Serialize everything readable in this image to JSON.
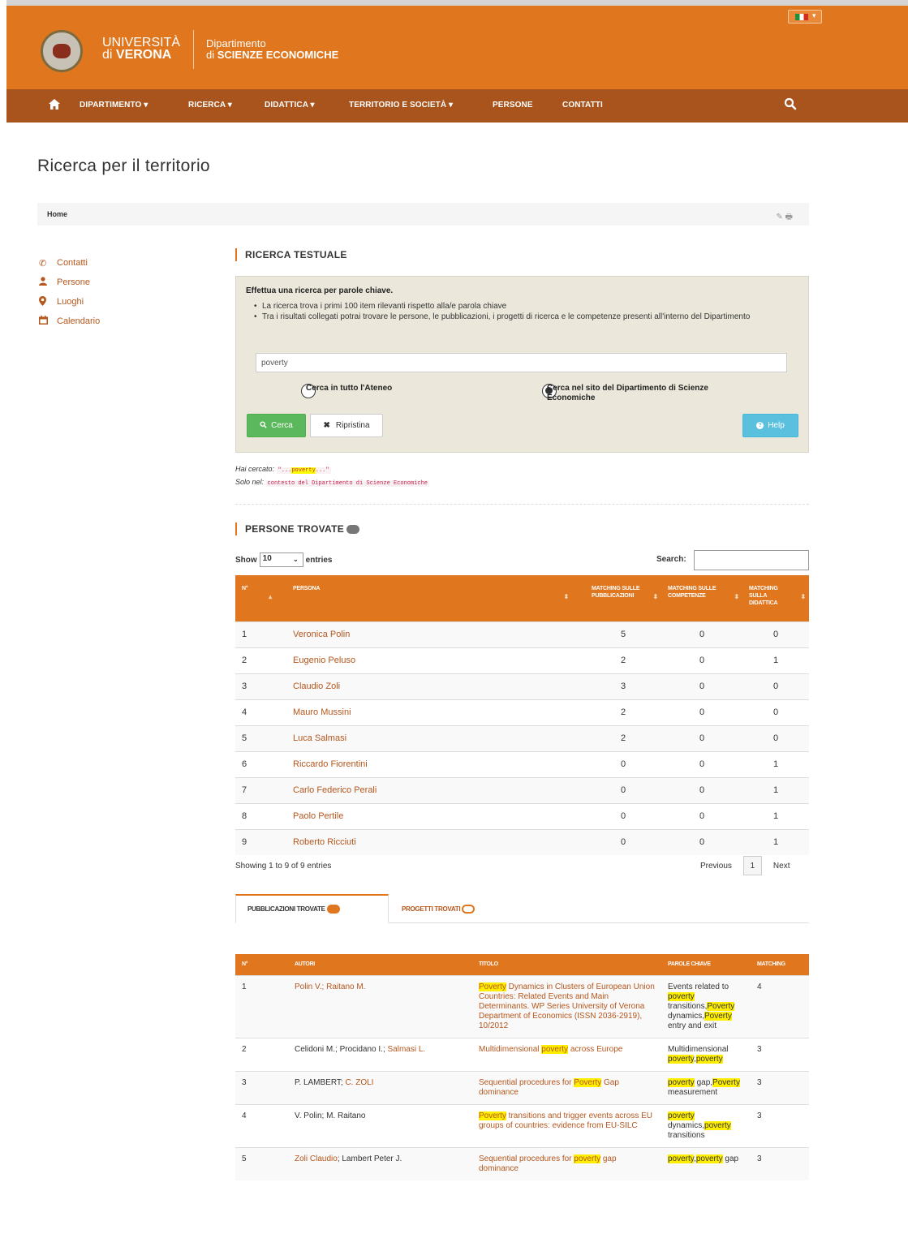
{
  "header": {
    "univ_line1": "UNIVERSITÀ",
    "univ_line2_prefix": "di ",
    "univ_line2": "VERONA",
    "dept_line1": "Dipartimento",
    "dept_line2_prefix": "di ",
    "dept_line2": "SCIENZE ECONOMICHE"
  },
  "nav": {
    "items": [
      "DIPARTIMENTO ▾",
      "RICERCA ▾",
      "DIDATTICA ▾",
      "TERRITORIO E SOCIETÀ ▾",
      "PERSONE",
      "CONTATTI"
    ]
  },
  "page": {
    "title": "Ricerca per il territorio",
    "breadcrumb_home": "Home"
  },
  "sidebar": {
    "items": [
      {
        "label": "Contatti",
        "icon": "phone-icon"
      },
      {
        "label": "Persone",
        "icon": "user-icon"
      },
      {
        "label": "Luoghi",
        "icon": "map-marker-icon"
      },
      {
        "label": "Calendario",
        "icon": "calendar-icon"
      }
    ]
  },
  "text_search": {
    "section_title": "RICERCA TESTUALE",
    "heading": "Effettua una ricerca per parole chiave.",
    "bullets": [
      "La ricerca trova i primi 100 item rilevanti rispetto alla/e parola chiave",
      "Tra i risultati collegati potrai trovare le persone, le pubblicazioni, i progetti di ricerca e le competenze presenti all'interno del Dipartimento"
    ],
    "input_value": "poverty",
    "radio_ateneo": "Cerca in tutto l'Ateneo",
    "radio_dept": "Cerca nel sito del Dipartimento di Scienze Economiche",
    "btn_search": "Cerca",
    "btn_reset": "Ripristina",
    "btn_help": "Help"
  },
  "query_info": {
    "searched_label": "Hai cercato:",
    "searched_pre": "\"...",
    "searched_term": "poverty",
    "searched_post": "...\"",
    "only_label": "Solo nel:",
    "only_value": "contesto del Dipartimento di Scienze Economiche"
  },
  "people": {
    "section_title": "PERSONE TROVATE",
    "show_label": "Show",
    "entries_value": "10",
    "entries_label": "entries",
    "search_label": "Search:",
    "columns": [
      "N°",
      "PERSONA",
      "MATCHING SULLE PUBBLICAZIONI",
      "MATCHING SULLE COMPETENZE",
      "MATCHING SULLA DIDATTICA"
    ],
    "rows": [
      {
        "n": "1",
        "name": "Veronica Polin",
        "pub": "5",
        "comp": "0",
        "did": "0"
      },
      {
        "n": "2",
        "name": "Eugenio Peluso",
        "pub": "2",
        "comp": "0",
        "did": "1"
      },
      {
        "n": "3",
        "name": "Claudio Zoli",
        "pub": "3",
        "comp": "0",
        "did": "0"
      },
      {
        "n": "4",
        "name": "Mauro Mussini",
        "pub": "2",
        "comp": "0",
        "did": "0"
      },
      {
        "n": "5",
        "name": "Luca Salmasi",
        "pub": "2",
        "comp": "0",
        "did": "0"
      },
      {
        "n": "6",
        "name": "Riccardo Fiorentini",
        "pub": "0",
        "comp": "0",
        "did": "1"
      },
      {
        "n": "7",
        "name": "Carlo Federico Perali",
        "pub": "0",
        "comp": "0",
        "did": "1"
      },
      {
        "n": "8",
        "name": "Paolo Pertile",
        "pub": "0",
        "comp": "0",
        "did": "1"
      },
      {
        "n": "9",
        "name": "Roberto Ricciuti",
        "pub": "0",
        "comp": "0",
        "did": "1"
      }
    ],
    "footer": "Showing 1 to 9 of 9 entries",
    "prev": "Previous",
    "page": "1",
    "next": "Next"
  },
  "tabs": {
    "pub": "PUBBLICAZIONI TROVATE",
    "proj": "PROGETTI TROVATI"
  },
  "publications": {
    "columns": [
      "N°",
      "AUTORI",
      "TITOLO",
      "PAROLE CHIAVE",
      "MATCHING"
    ],
    "rows": [
      {
        "n": "1",
        "authors": "Polin V.; Raitano M.",
        "title": "Poverty Dynamics in Clusters of European Union Countries: Related Events and Main Determinants. WP Series University of Verona Department of Economics (ISSN 2036-2919), 10/2012",
        "keywords": "Events related to poverty transitions,Poverty dynamics,Poverty entry and exit",
        "matching": "4"
      },
      {
        "n": "2",
        "authors": "Celidoni M.; Procidano I.; Salmasi L.",
        "title": "Multidimensional poverty across Europe",
        "keywords": "Multidimensional poverty,poverty",
        "matching": "3"
      },
      {
        "n": "3",
        "authors": "P. LAMBERT; C. ZOLI",
        "title": "Sequential procedures for Poverty Gap dominance",
        "keywords": "poverty gap,Poverty measurement",
        "matching": "3"
      },
      {
        "n": "4",
        "authors": "V. Polin; M. Raitano",
        "title": "Poverty transitions and trigger events across EU groups of countries: evidence from EU-SILC",
        "keywords": "poverty dynamics,poverty transitions",
        "matching": "3"
      },
      {
        "n": "5",
        "authors": "Zoli Claudio; Lambert Peter J.",
        "title": "Sequential procedures for poverty gap dominance",
        "keywords": "poverty,poverty gap",
        "matching": "3"
      }
    ]
  }
}
